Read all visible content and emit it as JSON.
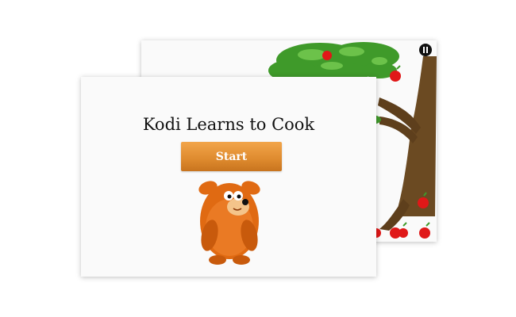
{
  "game": {
    "title": "Kodi Learns to Cook",
    "start_label": "Start"
  },
  "background_scene": {
    "description_icons": [
      "apple-tree-icon",
      "apple-icon",
      "pause-icon"
    ],
    "apple_count": 7
  },
  "colors": {
    "button_top": "#f2a54a",
    "button_bottom": "#c8741e",
    "bear_fur": "#e06a12",
    "leaf_green": "#3f9a2a",
    "trunk_brown": "#6b4a22",
    "apple_red": "#e01818"
  }
}
